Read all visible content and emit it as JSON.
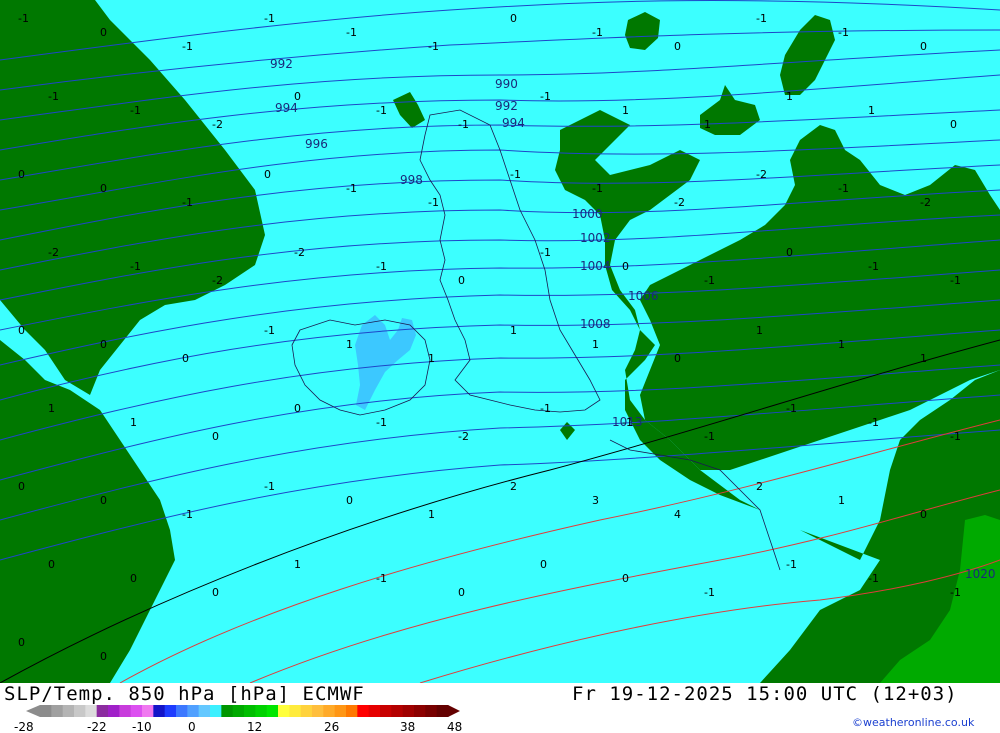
{
  "header": {
    "title": "SLP/Temp. 850 hPa [hPa] ECMWF",
    "valid_time": "Fr 19-12-2025 15:00 UTC (12+03)",
    "credit": "©weatheronline.co.uk"
  },
  "legend": {
    "tick_labels": [
      "-28",
      "-22",
      "-10",
      "0",
      "12",
      "26",
      "38",
      "48"
    ],
    "colors": [
      "#8c8c8c",
      "#a0a0a0",
      "#b4b4b4",
      "#c8c8c8",
      "#dcdcdc",
      "#8c2ca0",
      "#a020c8",
      "#c83cdc",
      "#dc50f0",
      "#f078f0",
      "#1414c8",
      "#1e3cff",
      "#3c78ff",
      "#50a0ff",
      "#64c8ff",
      "#3cf0ff",
      "#009600",
      "#00aa00",
      "#00be00",
      "#00d200",
      "#00e600",
      "#ffff3c",
      "#ffeb3c",
      "#ffd23c",
      "#ffbe3c",
      "#ffaa28",
      "#ff9614",
      "#ff7800",
      "#ff0000",
      "#e60000",
      "#c80000",
      "#b40000",
      "#a00000",
      "#8c0000",
      "#780000",
      "#640000"
    ]
  },
  "map": {
    "colors": {
      "sea": "#3cffff",
      "land_mild": "#007800",
      "land_warm": "#00aa00",
      "cold_pocket": "#3cc8ff",
      "isobar": "#1e46c8",
      "temp_line_warm": "#e03c3c",
      "freezing_line": "#000000"
    },
    "isobar_labels": [
      "992",
      "990",
      "994",
      "992",
      "994",
      "996",
      "998",
      "1000",
      "1002",
      "1004",
      "1006",
      "1008",
      "1013",
      "1020"
    ],
    "temperature_labels": [
      "-1",
      "0",
      "-1",
      "-1",
      "-1",
      "-1",
      "0",
      "-1",
      "0",
      "-1",
      "-1",
      "0",
      "-1",
      "-1",
      "-2",
      "0",
      "-1",
      "-1",
      "-1",
      "1",
      "1",
      "1",
      "1",
      "0",
      "0",
      "0",
      "-1",
      "0",
      "-1",
      "-1",
      "-1",
      "-1",
      "-2",
      "-2",
      "-1",
      "-2",
      "-2",
      "-1",
      "-2",
      "-2",
      "-1",
      "0",
      "-1",
      "0",
      "-1",
      "0",
      "-1",
      "-1",
      "0",
      "0",
      "0",
      "-1",
      "1",
      "1",
      "1",
      "1",
      "0",
      "1",
      "1",
      "1",
      "1",
      "1",
      "0",
      "0",
      "-1",
      "-2",
      "-1",
      "-1",
      "-1",
      "-1",
      "-1",
      "-1",
      "0",
      "0",
      "-1",
      "-1",
      "0",
      "1",
      "2",
      "3",
      "4",
      "2",
      "1",
      "0",
      "0",
      "0",
      "0",
      "1",
      "-1",
      "0",
      "0",
      "0",
      "-1",
      "-1",
      "-1",
      "-1",
      "0",
      "0"
    ]
  }
}
